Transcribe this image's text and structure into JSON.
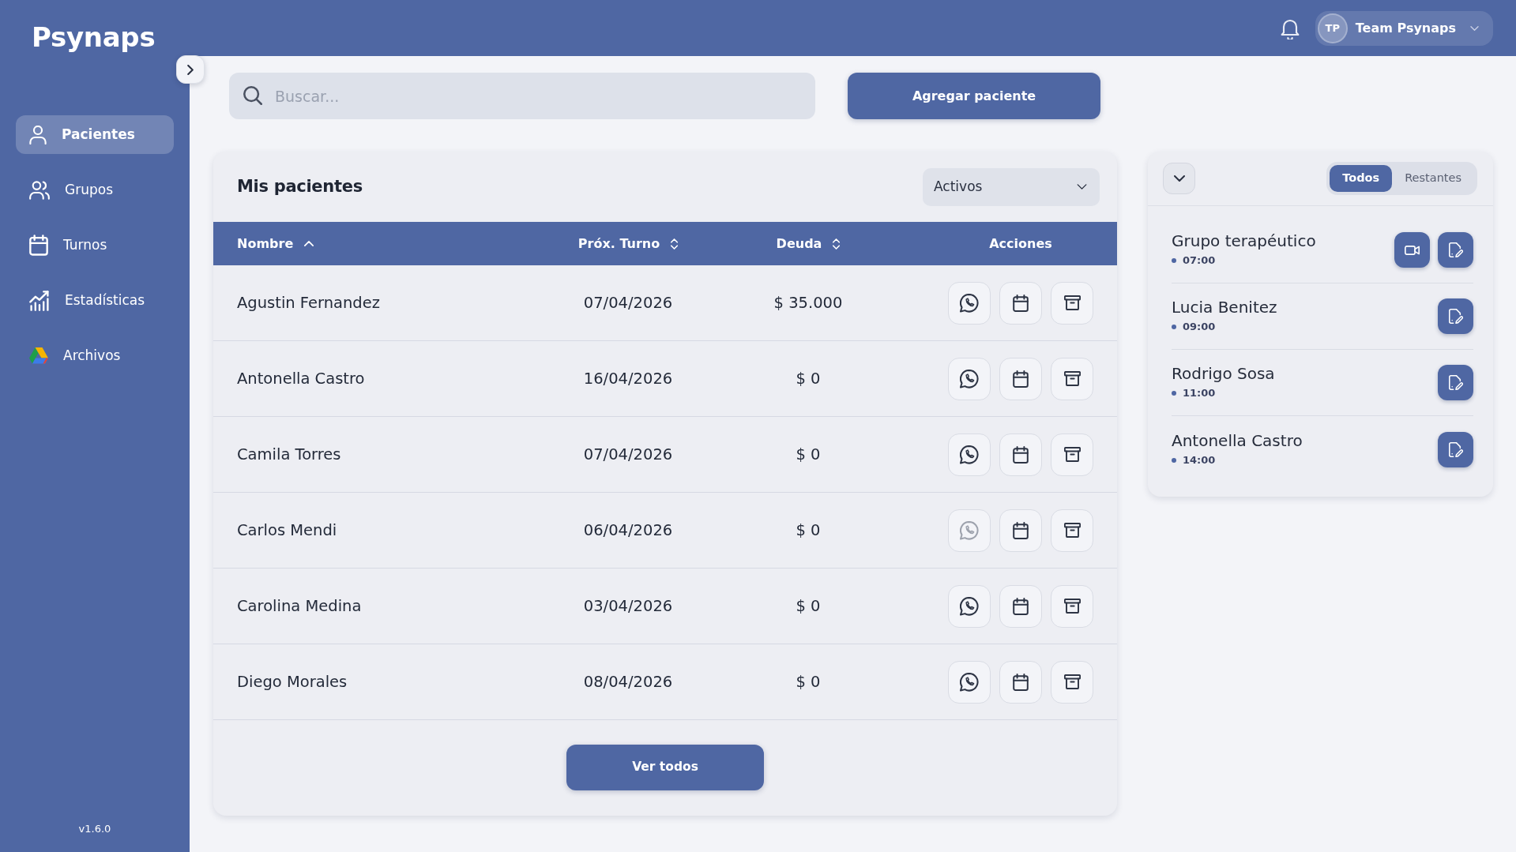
{
  "app": {
    "name": "Psynaps"
  },
  "sidebar": {
    "items": [
      {
        "label": "Pacientes",
        "selected": true
      },
      {
        "label": "Grupos",
        "selected": false
      },
      {
        "label": "Turnos",
        "selected": false
      },
      {
        "label": "Estadísticas",
        "selected": false
      },
      {
        "label": "Archivos",
        "selected": false
      }
    ],
    "version": "v1.6.0"
  },
  "header": {
    "user": {
      "initials": "TP",
      "name": "Team Psynaps"
    }
  },
  "search": {
    "placeholder": "Buscar..."
  },
  "add_button": {
    "label": "Agregar paciente"
  },
  "patients": {
    "title": "Mis pacientes",
    "filter": {
      "value": "Activos"
    },
    "columns": [
      {
        "label": "Nombre",
        "sortable": true,
        "sorted": true
      },
      {
        "label": "Próx. Turno",
        "sortable": true,
        "sorted": false
      },
      {
        "label": "Deuda",
        "sortable": true,
        "sorted": false
      },
      {
        "label": "Acciones",
        "sortable": false
      }
    ],
    "rows": [
      {
        "name": "Agustin Fernandez",
        "next_appointment": "07/04/2026",
        "debt": "$ 35.000",
        "whatsapp_disabled": false
      },
      {
        "name": "Antonella Castro",
        "next_appointment": "16/04/2026",
        "debt": "$ 0",
        "whatsapp_disabled": false
      },
      {
        "name": "Camila Torres",
        "next_appointment": "07/04/2026",
        "debt": "$ 0",
        "whatsapp_disabled": false
      },
      {
        "name": "Carlos Mendi",
        "next_appointment": "06/04/2026",
        "debt": "$ 0",
        "whatsapp_disabled": true
      },
      {
        "name": "Carolina Medina",
        "next_appointment": "03/04/2026",
        "debt": "$ 0",
        "whatsapp_disabled": false
      },
      {
        "name": "Diego Morales",
        "next_appointment": "08/04/2026",
        "debt": "$ 0",
        "whatsapp_disabled": false
      }
    ],
    "footer_button": {
      "label": "Ver todos"
    }
  },
  "agenda": {
    "tabs": [
      {
        "label": "Todos",
        "selected": true
      },
      {
        "label": "Restantes",
        "selected": false
      }
    ],
    "items": [
      {
        "title": "Grupo terapéutico",
        "time": "07:00",
        "video": true
      },
      {
        "title": "Lucia Benitez",
        "time": "09:00",
        "video": false
      },
      {
        "title": "Rodrigo Sosa",
        "time": "11:00",
        "video": false
      },
      {
        "title": "Antonella Castro",
        "time": "14:00",
        "video": false
      }
    ]
  }
}
